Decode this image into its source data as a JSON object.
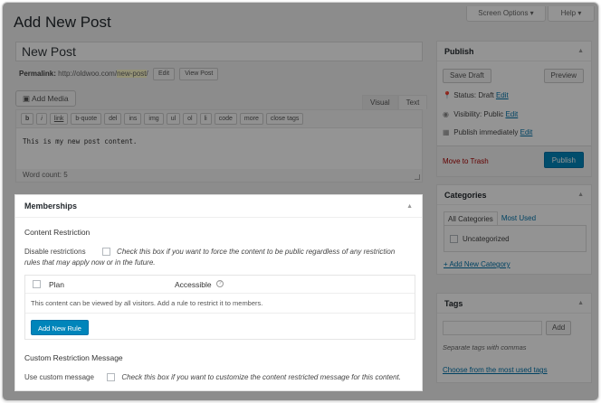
{
  "header": {
    "page_title": "Add New Post",
    "screen_options": "Screen Options",
    "help": "Help"
  },
  "post": {
    "title_value": "New Post",
    "permalink_label": "Permalink:",
    "permalink_base": "http://oldwoo.com/",
    "permalink_slug": "new-post",
    "permalink_tail": "/",
    "edit_button": "Edit",
    "view_post_button": "View Post"
  },
  "editor": {
    "add_media": "Add Media",
    "tab_visual": "Visual",
    "tab_text": "Text",
    "quicktags": [
      "b",
      "i",
      "link",
      "b-quote",
      "del",
      "ins",
      "img",
      "ul",
      "ol",
      "li",
      "code",
      "more",
      "close tags"
    ],
    "content": "This is my new post content.",
    "word_count": "Word count: 5"
  },
  "publish": {
    "title": "Publish",
    "save_draft": "Save Draft",
    "preview": "Preview",
    "status_label": "Status: Draft",
    "visibility_label": "Visibility: Public",
    "schedule_label": "Publish immediately",
    "edit_link": "Edit",
    "trash": "Move to Trash",
    "publish_button": "Publish"
  },
  "categories": {
    "title": "Categories",
    "tab_all": "All Categories",
    "tab_most_used": "Most Used",
    "items": [
      "Uncategorized"
    ],
    "add_new": "+ Add New Category"
  },
  "tags": {
    "title": "Tags",
    "add_button": "Add",
    "hint": "Separate tags with commas",
    "choose_link": "Choose from the most used tags"
  },
  "memberships": {
    "title": "Memberships",
    "content_restriction_heading": "Content Restriction",
    "disable_label": "Disable restrictions",
    "disable_desc_line1": "Check this box if you want to force the content to be public regardless of any restriction",
    "disable_desc_line2": "rules that may apply now or in the future.",
    "col_plan": "Plan",
    "col_accessible": "Accessible",
    "empty_message": "This content can be viewed by all visitors. Add a rule to restrict it to members.",
    "add_rule_button": "Add New Rule",
    "custom_message_heading": "Custom Restriction Message",
    "use_custom_label": "Use custom message",
    "use_custom_desc": "Check this box if you want to customize the content restricted message for this content."
  },
  "colors": {
    "accent": "#0085ba",
    "link": "#0073aa",
    "trash": "#a00000"
  }
}
